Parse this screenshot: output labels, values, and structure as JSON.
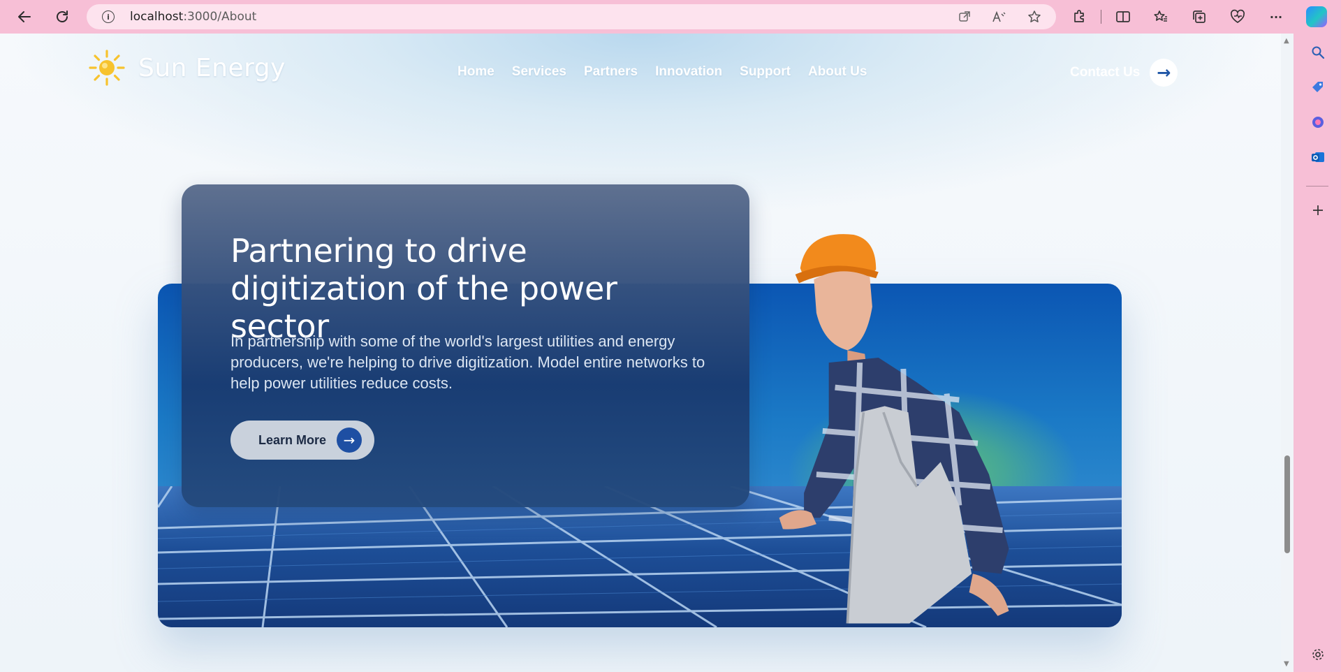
{
  "browser": {
    "url_host": "localhost",
    "url_path": ":3000/About",
    "icons": {
      "back": "back-arrow-icon",
      "refresh": "refresh-icon",
      "info": "site-info-icon",
      "open_in_app": "open-in-app-icon",
      "read_aloud": "read-aloud-icon",
      "favorite": "favorite-star-icon",
      "extensions": "extensions-icon",
      "split_screen": "split-screen-icon",
      "favorites": "favorites-icon",
      "collections": "collections-icon",
      "browser_essentials": "browser-essentials-icon",
      "more": "more-icon",
      "copilot": "copilot-icon"
    },
    "info_glyph": "i",
    "more_glyph": "···"
  },
  "sidebar": {
    "icons": [
      "search-icon",
      "shopping-tag-icon",
      "copilot-app-icon",
      "outlook-icon",
      "add-icon",
      "settings-icon"
    ]
  },
  "site": {
    "brand": "Sun Energy",
    "nav": [
      "Home",
      "Services",
      "Partners",
      "Innovation",
      "Support",
      "About Us"
    ],
    "contact_label": "Contact Us",
    "arrow_glyph": "→"
  },
  "hero": {
    "title": "Partnering to drive digitization of the power sector",
    "description": "In partnership with some of the world's largest utilities and energy producers, we're helping to drive digitization. Model entire networks to help power utilities reduce costs.",
    "button_label": "Learn More",
    "arrow_glyph": "→"
  },
  "colors": {
    "browser_chrome": "#f7bfd6",
    "address_bar": "#fde3ee",
    "accent_blue": "#1e4fa3",
    "sun_yellow": "#f7c32e",
    "helmet_orange": "#f28a1c"
  }
}
